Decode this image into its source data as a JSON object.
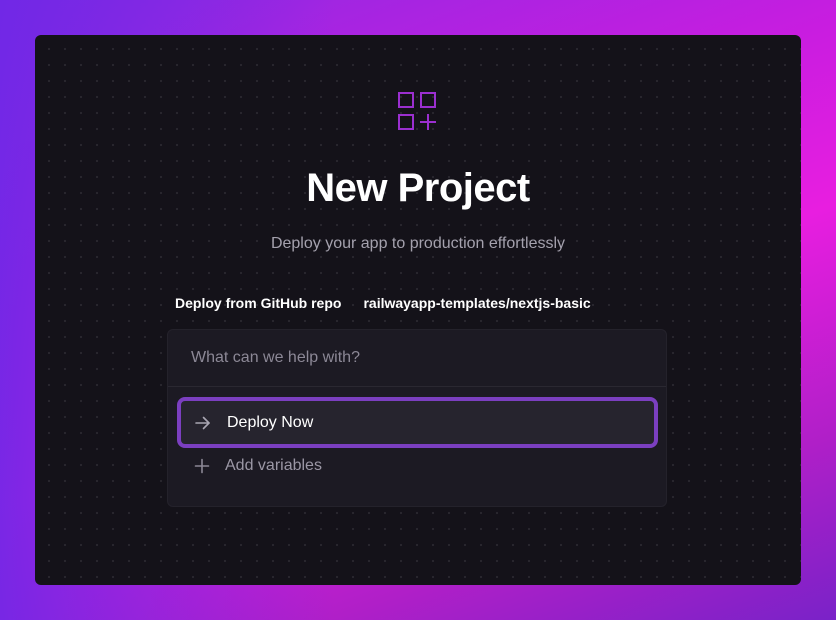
{
  "header": {
    "title": "New Project",
    "subtitle": "Deploy your app to production effortlessly",
    "logo_icon": "apps-add-icon",
    "accent_color": "#9b2fd0"
  },
  "source": {
    "label": "Deploy from GitHub repo",
    "repo": "railwayapp-templates/nextjs-basic"
  },
  "panel": {
    "prompt_placeholder": "What can we help with?",
    "prompt_value": "",
    "deploy_label": "Deploy Now",
    "deploy_icon": "arrow-right-icon",
    "add_variables_label": "Add variables",
    "add_variables_icon": "plus-icon",
    "highlight_color": "#7b3fc0"
  }
}
